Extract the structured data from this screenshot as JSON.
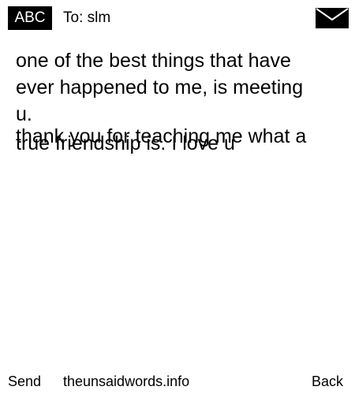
{
  "header": {
    "mode_label": "ABC",
    "recipient": "To: slm",
    "icon": "envelope-icon"
  },
  "message": {
    "lines": [
      "one of the best things that have",
      "ever happened to me, is meeting",
      "u.",
      "thank you for teaching me what a",
      "true friendship is. I love u"
    ]
  },
  "footer": {
    "send_label": "Send",
    "site_label": "theunsaidwords.info",
    "back_label": "Back"
  }
}
